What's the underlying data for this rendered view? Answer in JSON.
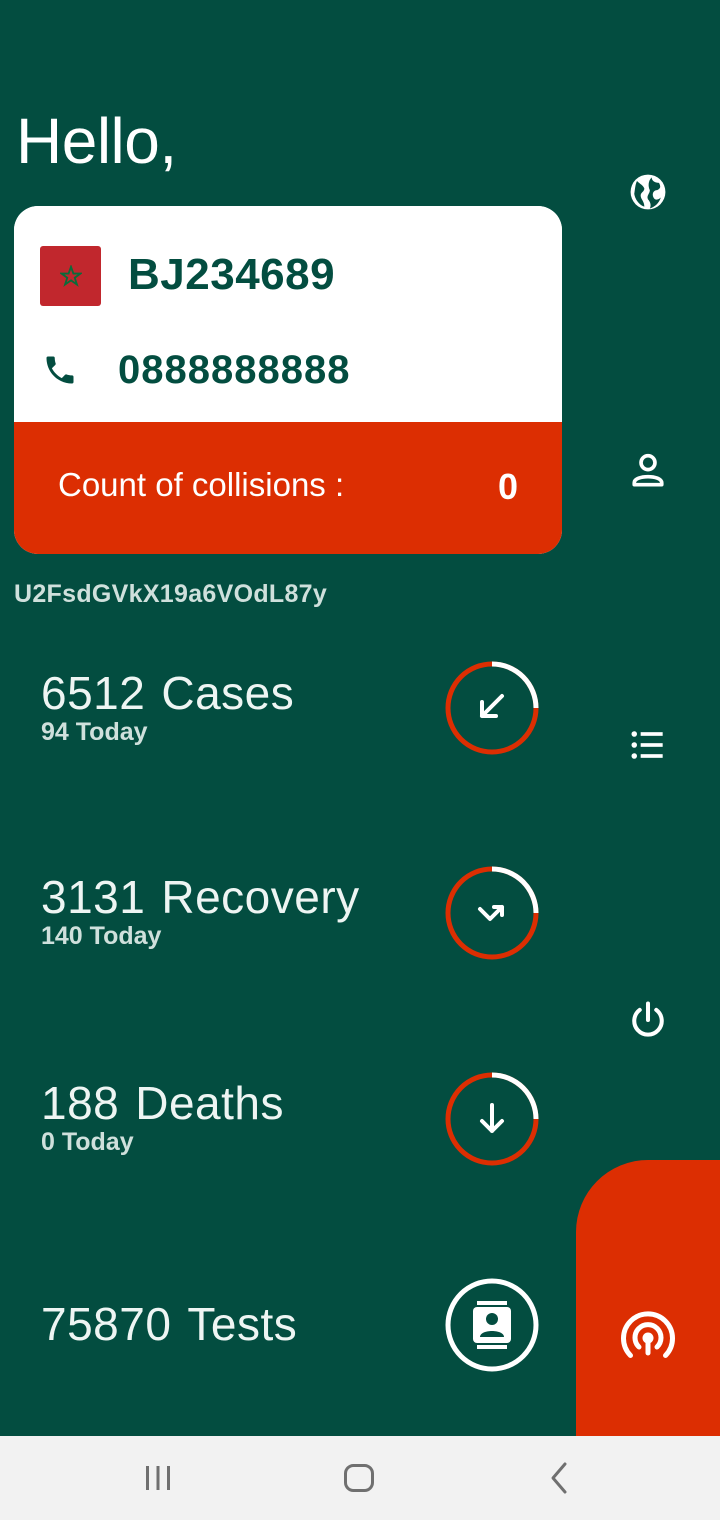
{
  "greeting": "Hello,",
  "card": {
    "user_id": "BJ234689",
    "phone": "0888888888",
    "collisions_label": "Count of collisions :",
    "collisions_value": "0"
  },
  "token": "U2FsdGVkX19a6VOdL87y",
  "stats": [
    {
      "value": "6512",
      "label": "Cases",
      "today": "94 Today",
      "icon": "arrow-down-left-icon"
    },
    {
      "value": "3131",
      "label": "Recovery",
      "today": "140 Today",
      "icon": "trend-up-icon"
    },
    {
      "value": "188",
      "label": "Deaths",
      "today": "0 Today",
      "icon": "arrow-down-icon"
    },
    {
      "value": "75870",
      "label": "Tests",
      "today": "",
      "icon": "contact-icon"
    }
  ],
  "side_nav": [
    "globe-icon",
    "profile-icon",
    "list-icon",
    "power-icon"
  ],
  "fab_icon": "broadcast-icon",
  "colors": {
    "background": "#034d40",
    "accent": "#dc2e02",
    "card": "#ffffff",
    "text_dark": "#034d40"
  }
}
